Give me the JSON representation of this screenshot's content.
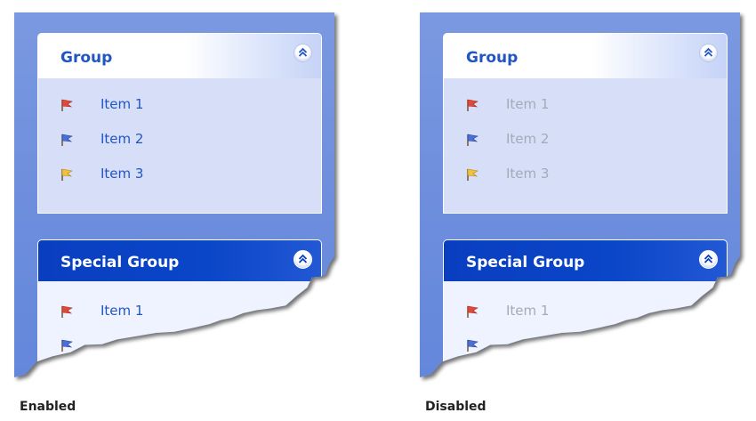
{
  "panels": [
    {
      "state": "enabled",
      "caption": "Enabled",
      "groups": [
        {
          "title": "Group",
          "items": [
            {
              "label": "Item 1",
              "icon": "red-flag-icon"
            },
            {
              "label": "Item 2",
              "icon": "blue-flag-icon"
            },
            {
              "label": "Item 3",
              "icon": "yellow-flag-icon"
            }
          ]
        },
        {
          "title": "Special Group",
          "items": [
            {
              "label": "Item 1",
              "icon": "red-flag-icon"
            },
            {
              "label": "",
              "icon": "blue-flag-icon"
            }
          ]
        }
      ]
    },
    {
      "state": "disabled",
      "caption": "Disabled",
      "groups": [
        {
          "title": "Group",
          "items": [
            {
              "label": "Item 1",
              "icon": "red-flag-icon"
            },
            {
              "label": "Item 2",
              "icon": "blue-flag-icon"
            },
            {
              "label": "Item 3",
              "icon": "yellow-flag-icon"
            }
          ]
        },
        {
          "title": "Special Group",
          "items": [
            {
              "label": "Item 1",
              "icon": "red-flag-icon"
            },
            {
              "label": "",
              "icon": "blue-flag-icon"
            }
          ]
        }
      ]
    }
  ],
  "colors": {
    "pane_background": "#6f8fdd",
    "group_header_text": "#2155c4",
    "special_header_background": "#0a3ec0",
    "item_text_enabled": "#2155c4",
    "item_text_disabled": "#a4aab8",
    "flag_red": "#e0493a",
    "flag_blue": "#4a6fd6",
    "flag_yellow": "#f2c23a"
  }
}
